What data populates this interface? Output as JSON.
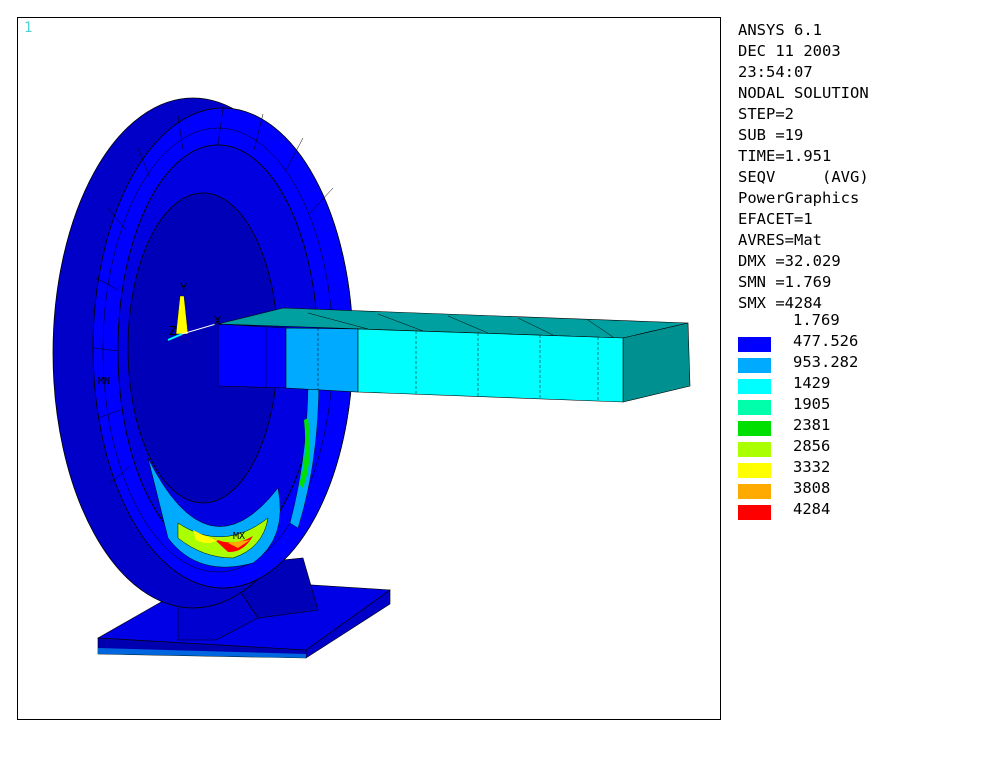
{
  "window": {
    "number": "1"
  },
  "info_lines": [
    "ANSYS 6.1",
    "DEC 11 2003",
    "23:54:07",
    "NODAL SOLUTION",
    "STEP=2",
    "SUB =19",
    "TIME=1.951",
    "SEQV     (AVG)",
    "PowerGraphics",
    "EFACET=1",
    "AVRES=Mat",
    "DMX =32.029",
    "SMN =1.769",
    "SMX =4284"
  ],
  "legend": {
    "min_label": "1.769",
    "bands": [
      {
        "value": "477.526",
        "color": "#0000ff"
      },
      {
        "value": "953.282",
        "color": "#00aaff"
      },
      {
        "value": "1429",
        "color": "#00ffff"
      },
      {
        "value": "1905",
        "color": "#00ffaa"
      },
      {
        "value": "2381",
        "color": "#00e000"
      },
      {
        "value": "2856",
        "color": "#aaff00"
      },
      {
        "value": "3332",
        "color": "#ffff00"
      },
      {
        "value": "3808",
        "color": "#ffaa00"
      },
      {
        "value": "4284",
        "color": "#ff0000"
      }
    ]
  },
  "triad": {
    "y": "Y",
    "z": "Z",
    "x": "X"
  },
  "markers": {
    "min": "MN",
    "max": "MX"
  }
}
